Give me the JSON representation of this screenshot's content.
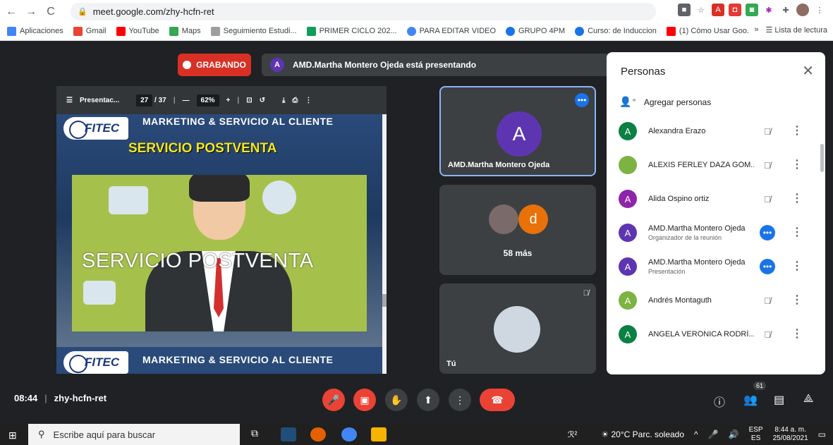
{
  "browser": {
    "url": "meet.google.com/zhy-hcfn-ret",
    "bookmarks": [
      "Aplicaciones",
      "Gmail",
      "YouTube",
      "Maps",
      "Seguimiento Estudi...",
      "PRIMER CICLO 202...",
      "PARA EDITAR VIDEO",
      "GRUPO 4PM",
      "Curso: de Induccion",
      "(1) Cómo Usar Goo..."
    ],
    "more_bookmarks": "»",
    "reading_list": "Lista de lectura"
  },
  "meet": {
    "recording_label": "GRABANDO",
    "presenter_avatar": "A",
    "presenting_text": "AMD.Martha Montero Ojeda está presentando",
    "pdf": {
      "title": "Presentac...",
      "page": "27",
      "total": "/ 37",
      "zoom": "62%"
    },
    "slide": {
      "logo_text": "FITEC",
      "header": "MARKETING & SERVICIO AL CLIENTE",
      "subtitle": "SERVICIO POSTVENTA",
      "big_text": "SERVICIO POSTVENTA",
      "footer_header": "MARKETING & SERVICIO AL CLIENTE"
    },
    "tiles": {
      "main_name": "AMD.Martha Montero Ojeda",
      "main_avatar": "A",
      "more_avatar": "d",
      "more_label": "58 más",
      "you_label": "Tú"
    },
    "panel": {
      "title": "Personas",
      "add_label": "Agregar personas",
      "people": [
        {
          "initial": "A",
          "name": "Alexandra Erazo",
          "sub": "",
          "color": "#0b8043",
          "state": "muted"
        },
        {
          "initial": "",
          "name": "ALEXIS FERLEY DAZA GÓM...",
          "sub": "",
          "color": "#7cb342",
          "state": "muted"
        },
        {
          "initial": "A",
          "name": "Alida Ospino ortiz",
          "sub": "",
          "color": "#8e24aa",
          "state": "muted"
        },
        {
          "initial": "A",
          "name": "AMD.Martha Montero Ojeda",
          "sub": "Organizador de la reunión",
          "color": "#5e35b1",
          "state": "active"
        },
        {
          "initial": "A",
          "name": "AMD.Martha Montero Ojeda",
          "sub": "Presentación",
          "color": "#5e35b1",
          "state": "active"
        },
        {
          "initial": "A",
          "name": "Andrés Montaguth",
          "sub": "",
          "color": "#7cb342",
          "state": "muted"
        },
        {
          "initial": "A",
          "name": "ANGELA VERÓNICA RODRÍ...",
          "sub": "",
          "color": "#0b8043",
          "state": "muted"
        }
      ]
    },
    "bottom": {
      "time": "08:44",
      "code": "zhy-hcfn-ret",
      "participants_count": "61"
    }
  },
  "taskbar": {
    "search_placeholder": "Escribe aquí para buscar",
    "weather": "20°C  Parc. soleado",
    "lang1": "ESP",
    "lang2": "ES",
    "time": "8:44 a. m.",
    "date": "25/08/2021"
  }
}
